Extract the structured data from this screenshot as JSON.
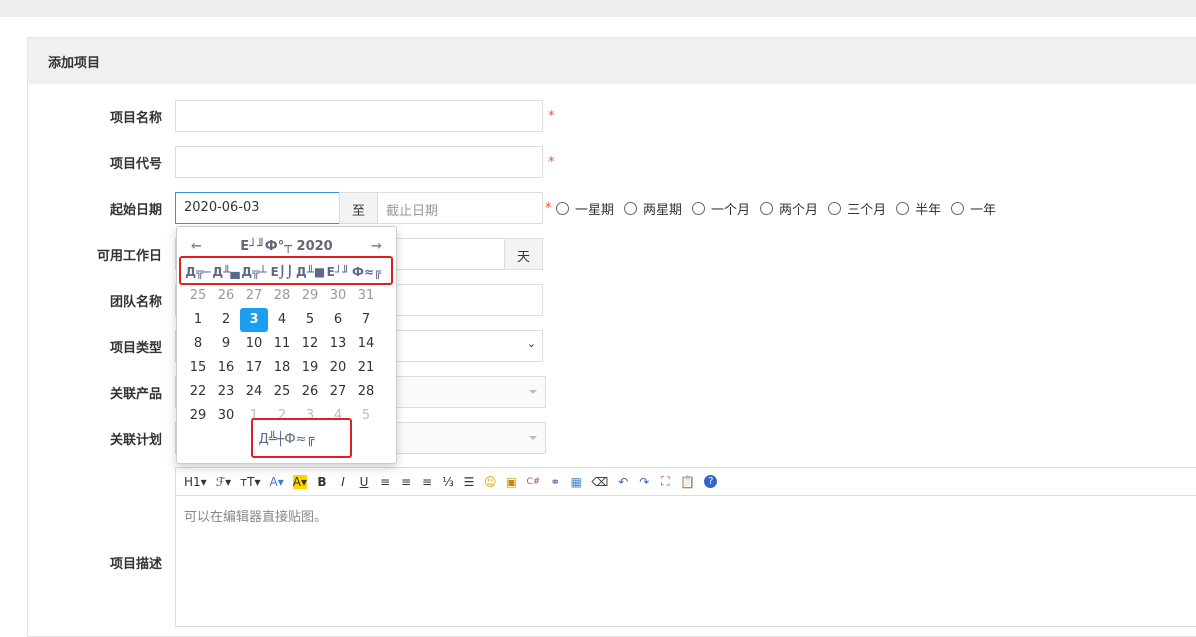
{
  "header": {
    "title": "添加项目"
  },
  "form": {
    "name_label": "项目名称",
    "code_label": "项目代号",
    "date_label": "起始日期",
    "workdays_label": "可用工作日",
    "team_label": "团队名称",
    "type_label": "项目类型",
    "product_label": "关联产品",
    "plan_label": "关联计划",
    "desc_label": "项目描述",
    "required": "*",
    "begin_value": "2020-06-03",
    "to": "至",
    "end_placeholder": "截止日期",
    "days_unit": "天",
    "durations": [
      "一星期",
      "两星期",
      "一个月",
      "两个月",
      "三个月",
      "半年",
      "一年"
    ]
  },
  "datepicker": {
    "prev": "←",
    "next": "→",
    "title": "Е┘╜Ф°┬ 2020",
    "weekdays": [
      "Д╦─",
      "Д╨▄",
      "Д╦┴",
      "Е⌡⌡",
      "Д╨■",
      "Е┘╜",
      "Ф≈╔"
    ],
    "days": [
      "25",
      "26",
      "27",
      "28",
      "29",
      "30",
      "31",
      "1",
      "2",
      "3",
      "4",
      "5",
      "6",
      "7",
      "8",
      "9",
      "10",
      "11",
      "12",
      "13",
      "14",
      "15",
      "16",
      "17",
      "18",
      "19",
      "20",
      "21",
      "22",
      "23",
      "24",
      "25",
      "26",
      "27",
      "28",
      "29",
      "30",
      "1",
      "2",
      "3",
      "4",
      "5"
    ],
    "today": "Д╩┼Ф≈╔"
  },
  "editor": {
    "tools": [
      "H1▾",
      "ℱ▾",
      "тT▾",
      "A▾",
      "A▾",
      "B",
      "I",
      "U",
      "≡",
      "≡",
      "≡",
      "⅓",
      "☰",
      "☺",
      "▣",
      "C#",
      "⚭",
      "▦",
      "⌫",
      "↶",
      "↷",
      "⛶",
      "📋",
      "?"
    ],
    "placeholder": "可以在编辑器直接贴图。"
  }
}
